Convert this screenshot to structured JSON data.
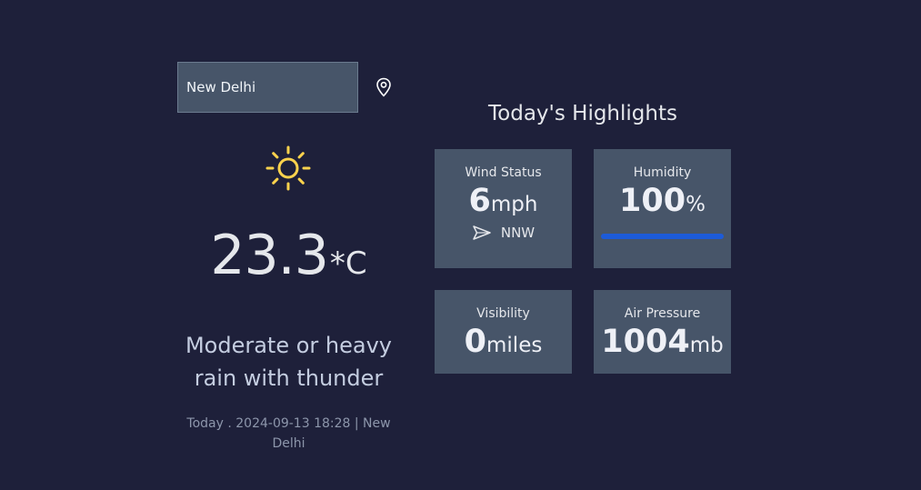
{
  "search": {
    "value": "New Delhi"
  },
  "current": {
    "temperature": "23.3",
    "unit": "*C",
    "condition_line1": "Moderate or heavy",
    "condition_line2": "rain with thunder",
    "datetime_line1": "Today . 2024-09-13 18:28 | New",
    "datetime_line2": "Delhi",
    "icon": "sun-icon",
    "icon_color": "#fcd34d"
  },
  "highlights": {
    "title": "Today's Highlights",
    "wind": {
      "label": "Wind Status",
      "value": "6",
      "unit": "mph",
      "direction": "NNW"
    },
    "humidity": {
      "label": "Humidity",
      "value": "100",
      "unit": "%",
      "percent": 100,
      "bar_color": "#1d5bd8"
    },
    "visibility": {
      "label": "Visibility",
      "value": "0",
      "unit": "miles"
    },
    "pressure": {
      "label": "Air Pressure",
      "value": "1004",
      "unit": "mb"
    }
  },
  "colors": {
    "background": "#1e203a",
    "card": "#475569"
  }
}
